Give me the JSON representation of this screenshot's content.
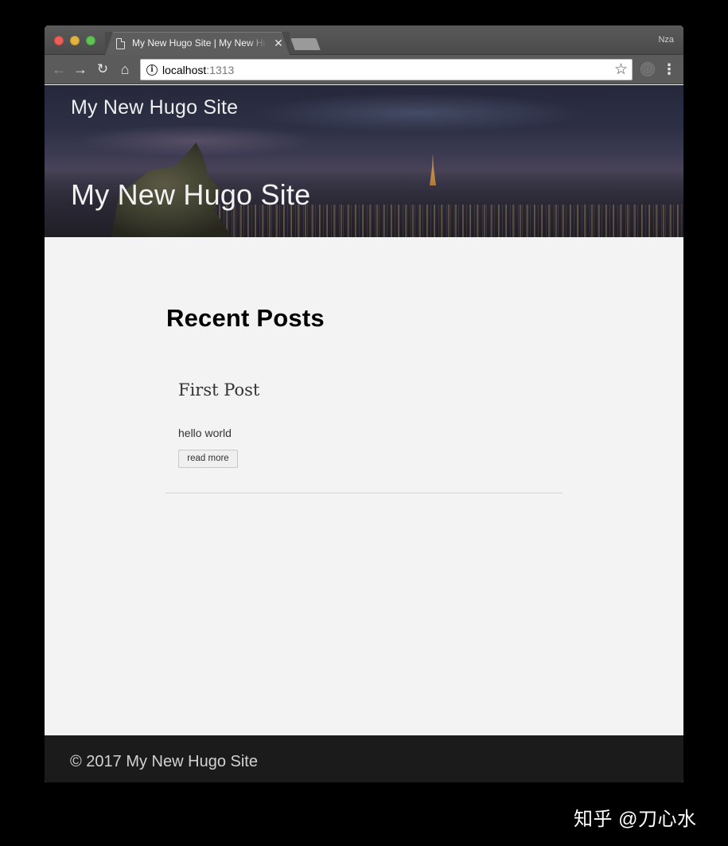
{
  "browser": {
    "tab_title": "My New Hugo Site | My New Hugo Site",
    "tab_close": "✕",
    "profile_name": "Nza",
    "url_host": "localhost",
    "url_port": ":1313",
    "icons": {
      "back": "←",
      "forward": "→",
      "reload": "↻",
      "home": "⌂",
      "info": "i",
      "star": "☆",
      "extension": "ⓘ",
      "menu": "⋮"
    },
    "traffic_colors": {
      "close": "#ec5f57",
      "minimize": "#e0b43e",
      "maximize": "#5fc453"
    }
  },
  "page": {
    "site_name": "My New Hugo Site",
    "hero_title": "My New Hugo Site",
    "section_title": "Recent Posts",
    "posts": [
      {
        "title": "First Post",
        "summary": "hello world",
        "read_more": "read more"
      }
    ],
    "footer": "© 2017 My New Hugo Site"
  },
  "watermark": "知乎 @刀心水"
}
